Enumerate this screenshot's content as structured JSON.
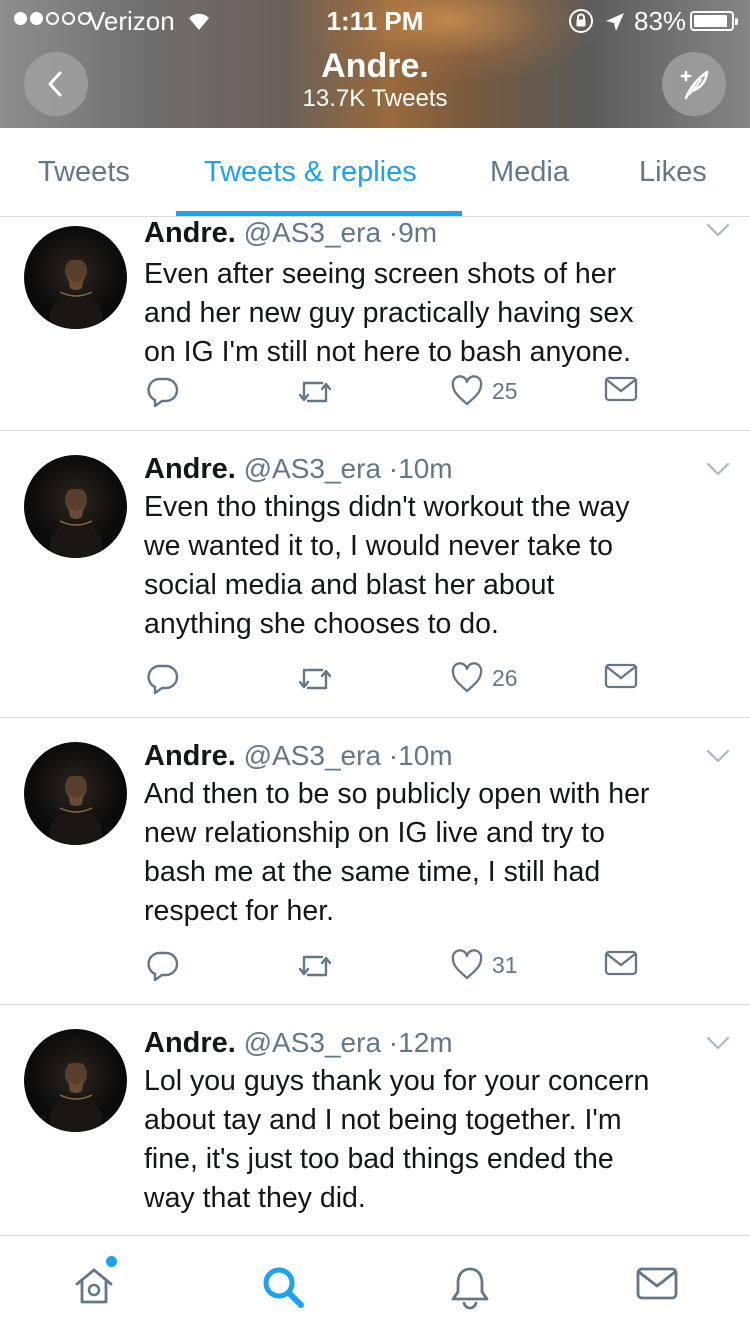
{
  "status_bar": {
    "carrier": "Verizon",
    "time": "1:11 PM",
    "battery": "83%",
    "battery_level": 0.83,
    "signal_bars_filled": 2,
    "signal_bars_total": 5
  },
  "header": {
    "name": "Andre.",
    "tweet_count": "13.7K Tweets",
    "back_icon": "chevron-left-icon",
    "compose_icon": "compose-tweet-icon"
  },
  "tabs": [
    {
      "label": "Tweets",
      "active": false
    },
    {
      "label": "Tweets & replies",
      "active": true
    },
    {
      "label": "Media",
      "active": false
    },
    {
      "label": "Likes",
      "active": false
    }
  ],
  "tweets": [
    {
      "author": "Andre.",
      "handle": "@AS3_era",
      "separator": "·",
      "time": "9m",
      "lines": [
        "Even after seeing screen shots of her",
        "and her new guy practically having sex",
        "on IG I'm still not here to bash anyone."
      ],
      "likes": "25"
    },
    {
      "author": "Andre.",
      "handle": "@AS3_era",
      "separator": "·",
      "time": "10m",
      "lines": [
        "Even tho things didn't workout the way",
        "we wanted it to, I would never take to",
        "social media and blast her about",
        "anything she chooses to do."
      ],
      "likes": "26"
    },
    {
      "author": "Andre.",
      "handle": "@AS3_era",
      "separator": "·",
      "time": "10m",
      "lines": [
        "And then to be so publicly open with her",
        "new relationship on IG live and try to",
        "bash me at the same time, I still had",
        "respect for her."
      ],
      "likes": "31"
    },
    {
      "author": "Andre.",
      "handle": "@AS3_era",
      "separator": "·",
      "time": "12m",
      "lines": [
        "Lol you guys thank you for your concern",
        "about tay and I not being together. I'm",
        "fine, it's just too bad things ended the",
        "way that they did."
      ],
      "likes": ""
    }
  ],
  "bottom_nav": [
    {
      "icon": "home-icon",
      "active": false,
      "badge": true
    },
    {
      "icon": "search-icon",
      "active": true
    },
    {
      "icon": "bell-icon",
      "active": false
    },
    {
      "icon": "mail-icon",
      "active": false
    }
  ],
  "colors": {
    "accent": "#1da1f2",
    "secondary_text": "#657786",
    "primary_text": "#14171a",
    "divider": "#d8dde1"
  }
}
